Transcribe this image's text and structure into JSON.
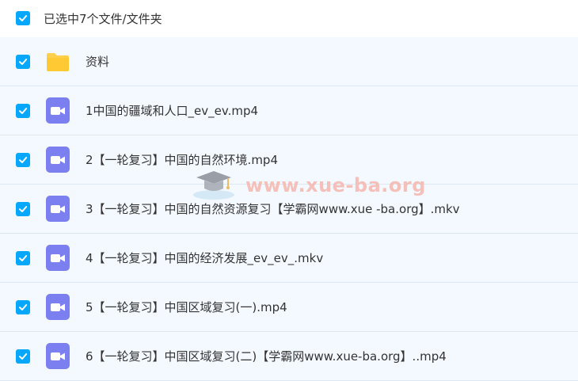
{
  "header": {
    "selected_label": "已选中7个文件/文件夹"
  },
  "items": [
    {
      "name": "资料",
      "type": "folder"
    },
    {
      "name": "1中国的疆域和人口_ev_ev.mp4",
      "type": "video"
    },
    {
      "name": "2【一轮复习】中国的自然环境.mp4",
      "type": "video"
    },
    {
      "name": "3【一轮复习】中国的自然资源复习【学霸网www.xue -ba.org】.mkv",
      "type": "video"
    },
    {
      "name": "4【一轮复习】中国的经济发展_ev_ev_.mkv",
      "type": "video"
    },
    {
      "name": "5【一轮复习】中国区域复习(一).mp4",
      "type": "video"
    },
    {
      "name": "6【一轮复习】中国区域复习(二)【学霸网www.xue-ba.org】..mp4",
      "type": "video"
    }
  ],
  "watermark": {
    "text": "www.xue-ba.org"
  },
  "colors": {
    "checkbox": "#06a7ff",
    "video_icon": "#7b7ff0",
    "folder": "#ffd04b",
    "row_bg": "#f4f9ff"
  },
  "icons": {
    "folder": "folder-icon",
    "video": "video-file-icon",
    "check": "checkmark-icon"
  }
}
